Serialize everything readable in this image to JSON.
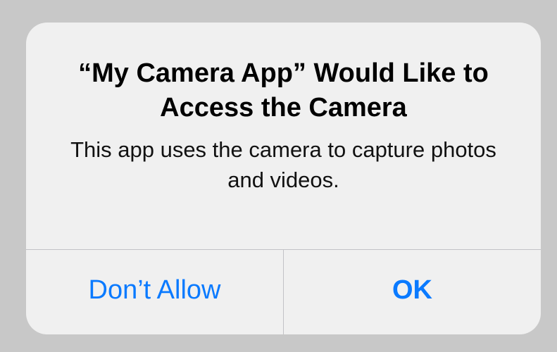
{
  "alert": {
    "title": "“My Camera App” Would Like to Access the Camera",
    "message": "This app uses the camera to capture photos and videos.",
    "buttons": {
      "deny_label": "Don’t Allow",
      "ok_label": "OK"
    }
  },
  "colors": {
    "backdrop": "#c8c8c8",
    "alert_background": "#f0f0f0",
    "button_text": "#0a7aff",
    "divider": "#c2c2c6"
  }
}
